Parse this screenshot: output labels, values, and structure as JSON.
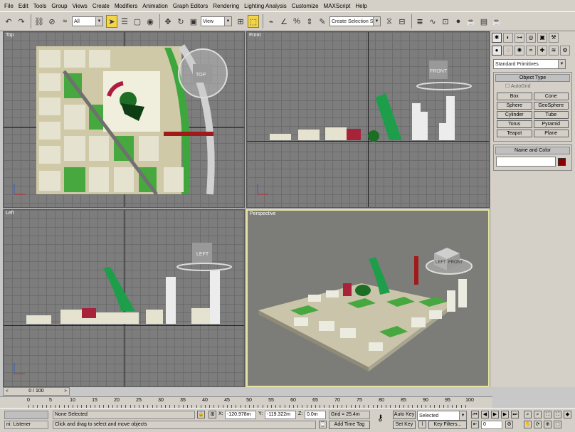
{
  "menu": [
    "File",
    "Edit",
    "Tools",
    "Group",
    "Views",
    "Create",
    "Modifiers",
    "Animation",
    "Graph Editors",
    "Rendering",
    "Lighting Analysis",
    "Customize",
    "MAXScript",
    "Help"
  ],
  "toolbar": {
    "selection_filter": "All",
    "ref_coord": "View",
    "named_selection": "Create Selection Set"
  },
  "viewports": {
    "top": {
      "label": "Top",
      "cube": "TOP"
    },
    "front": {
      "label": "Front",
      "cube": "FRONT"
    },
    "left": {
      "label": "Left",
      "cube": "LEFT"
    },
    "perspective": {
      "label": "Perspective",
      "cube_front": "LEFT",
      "cube_side": "FRONT"
    }
  },
  "command_panel": {
    "category": "Standard Primitives",
    "object_type_header": "Object Type",
    "autogrid": "AutoGrid",
    "primitives": [
      "Box",
      "Cone",
      "Sphere",
      "GeoSphere",
      "Cylinder",
      "Tube",
      "Torus",
      "Pyramid",
      "Teapot",
      "Plane"
    ],
    "name_color_header": "Name and Color",
    "name_value": "",
    "color": "#8b0000"
  },
  "timeline": {
    "slider": "0 / 100",
    "ticks": [
      "0",
      "5",
      "10",
      "15",
      "20",
      "25",
      "30",
      "35",
      "40",
      "45",
      "50",
      "55",
      "60",
      "65",
      "70",
      "75",
      "80",
      "85",
      "90",
      "95",
      "100"
    ]
  },
  "status": {
    "listener": "ni: Listener",
    "selection": "None Selected",
    "prompt": "Click and drag to select and move objects",
    "x_label": "X:",
    "x": "-120.978m",
    "y_label": "Y:",
    "y": "-119.322m",
    "z_label": "Z:",
    "z": "0.0m",
    "grid": "Grid = 25.4m",
    "add_time_tag": "Add Time Tag",
    "auto_key": "Auto Key",
    "set_key": "Set Key",
    "key_mode": "Selected",
    "key_filters": "Key Filters...",
    "frame": "0"
  }
}
